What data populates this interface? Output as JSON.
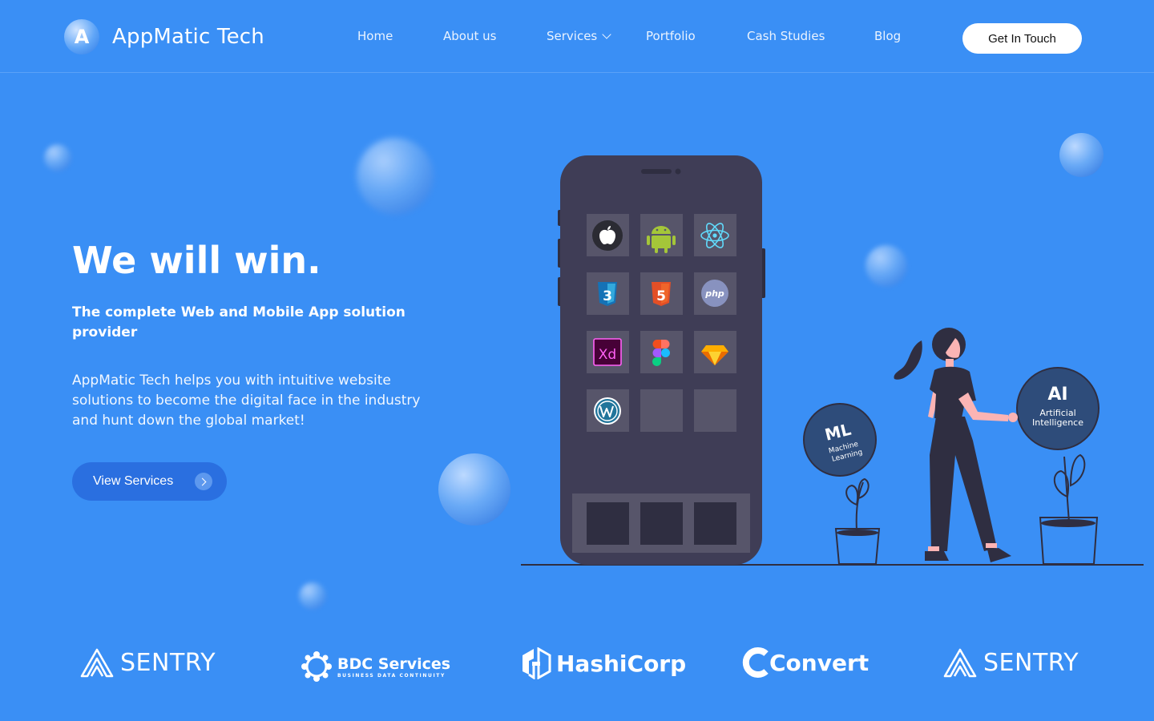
{
  "brand": {
    "logo_letter": "A",
    "name": "AppMatic Tech"
  },
  "nav": {
    "items": [
      {
        "label": "Home"
      },
      {
        "label": "About us"
      },
      {
        "label": "Services"
      },
      {
        "label": "Portfolio"
      },
      {
        "label": "Cash Studies"
      },
      {
        "label": "Blog"
      }
    ],
    "cta_label": "Get In Touch"
  },
  "hero": {
    "title": "We will win.",
    "subtitle": "The complete Web and Mobile App solution provider",
    "description": "AppMatic Tech helps you with intuitive website solutions to become the digital face in the industry and hunt down the global market!",
    "button_label": "View Services"
  },
  "illustration": {
    "app_icons": [
      "apple-icon",
      "android-icon",
      "react-icon",
      "css3-icon",
      "html5-icon",
      "php-icon",
      "adobe-xd-icon",
      "figma-icon",
      "sketch-icon",
      "wordpress-icon"
    ],
    "php_text": "php",
    "xd_text": "Xd",
    "html_badge": "5",
    "css_badge": "3",
    "ml_badge": {
      "abbr": "ML",
      "line1": "Machine",
      "line2": "Learning"
    },
    "ai_badge": {
      "abbr": "AI",
      "line1": "Artificial",
      "line2": "Intelligence"
    }
  },
  "partners": {
    "sentry_1": "SENTRY",
    "bdc_main": "BDC Services",
    "bdc_tagline": "BUSINESS DATA CONTINUITY",
    "hashicorp": "HashiCorp",
    "convert": "Convert",
    "sentry_2": "SENTRY"
  },
  "colors": {
    "background": "#3a8ff5",
    "button_primary": "#2a6fe0",
    "phone_body": "#3f3d56",
    "cta_background": "#ffffff"
  }
}
